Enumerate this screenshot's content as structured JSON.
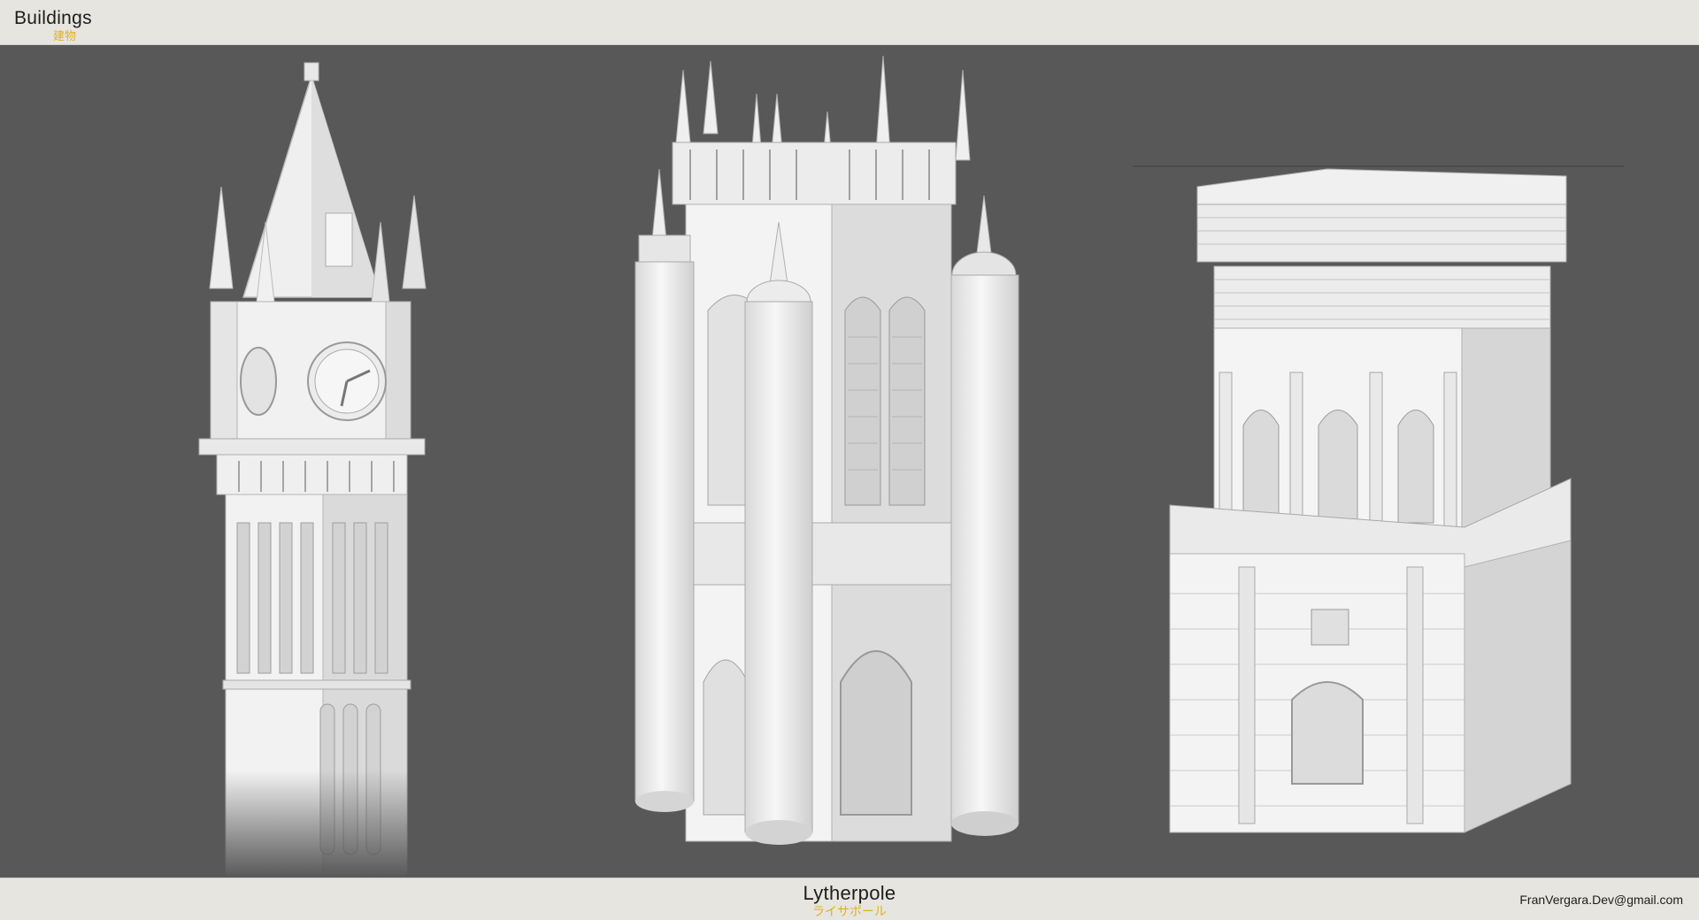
{
  "header": {
    "title": "Buildings",
    "subtitle": "建物"
  },
  "footer": {
    "project_title": "Lytherpole",
    "project_subtitle": "ライサポール",
    "email": "FranVergara.Dev@gmail.com"
  },
  "models": [
    {
      "name": "clock-tower"
    },
    {
      "name": "gothic-tower"
    },
    {
      "name": "neoclassical-block"
    }
  ],
  "colors": {
    "viewport_bg": "#585858",
    "bar_bg": "#e6e5e0",
    "accent": "#e0b21d",
    "model_light": "#f2f2f2",
    "model_shade": "#c9c9c9"
  }
}
